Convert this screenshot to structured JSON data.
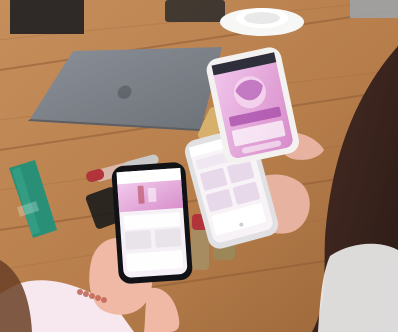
{
  "scene": {
    "description": "",
    "colors": {
      "table_wood": "#b77e4b",
      "table_wood_dark": "#8e5b34",
      "laptop": "#7b7f86",
      "phone_screen_pink": "#e6a7d7",
      "phone_screen_white": "#f6f1f6",
      "hair": "#3a241e",
      "skin": "#e7b3a0",
      "lipstick_red": "#b1343b",
      "bottle_teal": "#2a8f77"
    }
  }
}
